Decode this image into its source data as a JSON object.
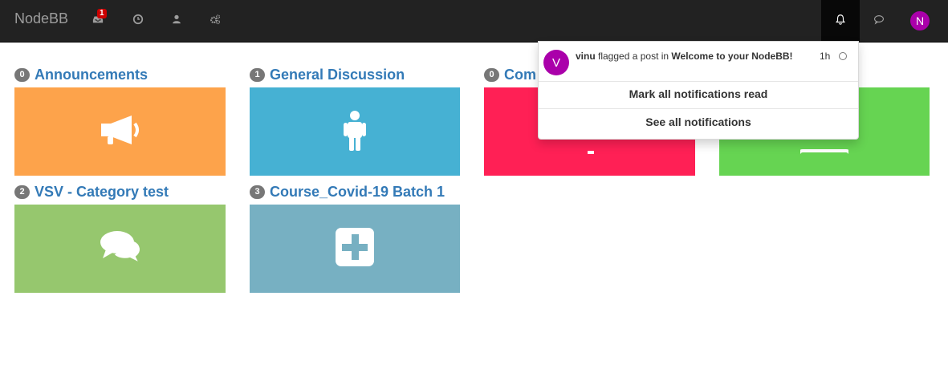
{
  "navbar": {
    "brand": "NodeBB",
    "unread_badge": "1",
    "user_initial": "N",
    "icons": [
      "inbox-icon",
      "clock-icon",
      "user-icon",
      "cogs-icon",
      "bell-icon",
      "chat-icon"
    ]
  },
  "categories": [
    {
      "count": "0",
      "name": "Announcements",
      "color": "#fda34b",
      "icon": "bullhorn-icon"
    },
    {
      "count": "1",
      "name": "General Discussion",
      "color": "#46b1d3",
      "icon": "male-icon"
    },
    {
      "count": "0",
      "name": "Com",
      "color": "#ff2055",
      "icon": "question-icon"
    },
    {
      "count": "",
      "name": "",
      "color": "#66d452",
      "icon": "laptop-icon"
    },
    {
      "count": "2",
      "name": "VSV - Category test",
      "color": "#96c76e",
      "icon": "comments-icon"
    },
    {
      "count": "3",
      "name": "Course_Covid-19 Batch 1",
      "color": "#77b0c2",
      "icon": "plus-square-icon"
    }
  ],
  "notifications": {
    "item": {
      "avatar_initial": "V",
      "user": "vinu",
      "text": " flagged a post in ",
      "topic": "Welcome to your NodeBB!",
      "time": "1h"
    },
    "mark_all_read": "Mark all notifications read",
    "see_all": "See all notifications"
  },
  "colors": {
    "navbar_bg": "#222222",
    "link": "#337ab7",
    "avatar": "#aa00aa",
    "badge": "#cc0000"
  }
}
